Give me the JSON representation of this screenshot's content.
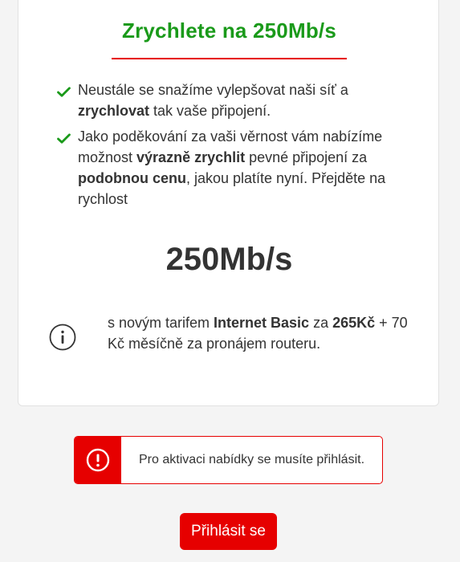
{
  "offer": {
    "title": "Zrychlete na 250Mb/s",
    "benefits": [
      {
        "parts": [
          "Neustále se snažíme vylepšovat naši síť a ",
          "zrychlovat",
          " tak vaše připojení."
        ]
      },
      {
        "parts": [
          "Jako poděkování za vaši věrnost vám nabízíme možnost ",
          "výrazně zrychlit",
          " pevné připojení za ",
          "podobnou cenu",
          ", jakou platíte nyní. Přejděte na rychlost"
        ]
      }
    ],
    "speed": "250Mb/s",
    "tariff": {
      "prefix": "s novým tarifem ",
      "name": "Internet Basic",
      "mid": " za ",
      "price": "265Kč",
      "suffix": " + 70 Kč měsíčně za pronájem routeru."
    }
  },
  "alert": {
    "text": "Pro aktivaci nabídky se musíte přihlásit.",
    "icon": "exclamation-circle-icon"
  },
  "login_button": {
    "label": "Přihlásit se"
  },
  "colors": {
    "accent_red": "#e60000",
    "success_green": "#1a9a1a",
    "text": "#333333"
  },
  "icons": {
    "benefit": "checkmark-icon",
    "info": "info-icon"
  }
}
